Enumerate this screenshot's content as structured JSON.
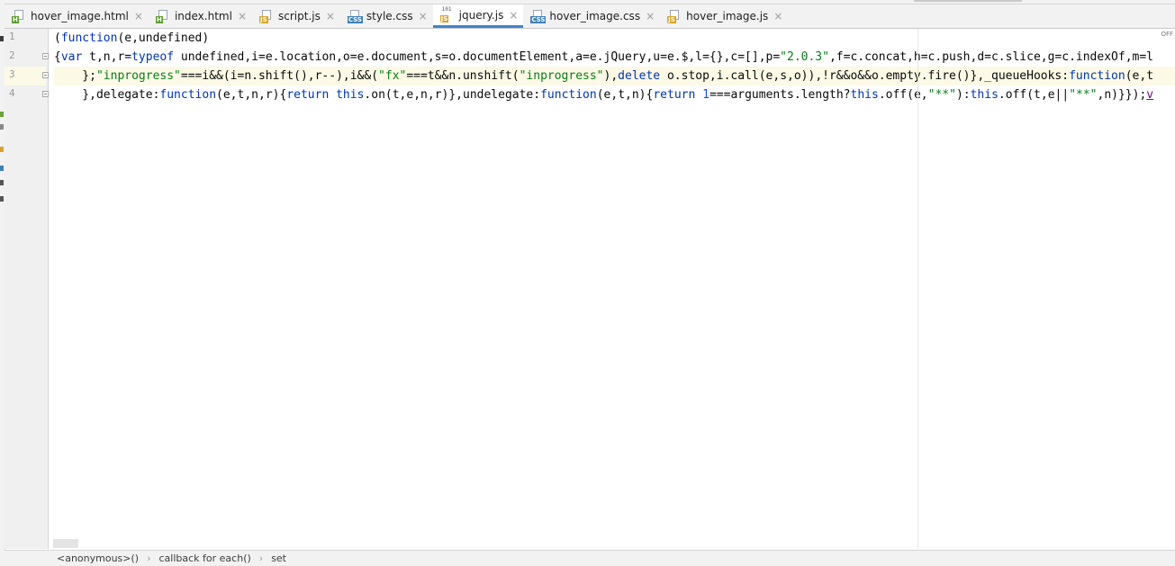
{
  "tabs": [
    {
      "label": "hover_image.html",
      "type": "html"
    },
    {
      "label": "index.html",
      "type": "html"
    },
    {
      "label": "script.js",
      "type": "js"
    },
    {
      "label": "style.css",
      "type": "css"
    },
    {
      "label": "jquery.js",
      "type": "js",
      "active": true
    },
    {
      "label": "hover_image.css",
      "type": "css"
    },
    {
      "label": "hover_image.js",
      "type": "js"
    }
  ],
  "badges": {
    "html": "H",
    "js": "JS",
    "css": "CSS",
    "binary": "101"
  },
  "close_glyph": "×",
  "line_numbers": [
    "1",
    "2",
    "3",
    "4"
  ],
  "code": {
    "l1": {
      "a": "(",
      "b": "function",
      "c": "(e,undefined)"
    },
    "l2": {
      "a": "{",
      "b": "var",
      "c": " t,n,r=",
      "d": "typeof",
      "e": " undefined,i=e.location,o=e.document,s=o.documentElement,a=e.jQuery,u=e.$,l={},c=[],p=",
      "f": "\"2.0.3\"",
      "g": ",f=c.concat,h=c.push,d=c.slice,g=c.indexOf,m=l"
    },
    "l3": {
      "a": "    };",
      "b": "\"inprogress\"",
      "c": "===i&&(i=n.shift(),r--),i&&(",
      "d": "\"fx\"",
      "e": "===t&&n.unshift(",
      "f": "\"inprogress\"",
      "g": "),",
      "h": "delete",
      "i": " o.stop,i.call(e,s,o)),!r&&o&&o.empty.fire()},_queueHooks:",
      "j": "function",
      "k": "(e,t"
    },
    "l4": {
      "a": "    },delegate:",
      "b": "function",
      "c": "(e,t,n,r){",
      "d": "return",
      "e": " ",
      "f": "this",
      "g": ".on(t,e,n,r)},undelegate:",
      "h": "function",
      "i": "(e,t,n){",
      "j": "return",
      "k": " ",
      "l": "1",
      "m": "===arguments.length?",
      "n": "this",
      "o": ".off(e,",
      "p": "\"**\"",
      "q": "):",
      "r": "this",
      "s": ".off(t,e||",
      "t": "\"**\"",
      "u": ",n)}});",
      "v": "v"
    }
  },
  "right_gutter_label": "OFF",
  "breadcrumbs": [
    "<anonymous>()",
    "callback for each()",
    "set"
  ],
  "breadcrumb_sep": "›",
  "colors": {
    "accent": "#4083c9",
    "keyword": "#0033b3",
    "string": "#067d17",
    "current_line": "#fcfae6"
  }
}
